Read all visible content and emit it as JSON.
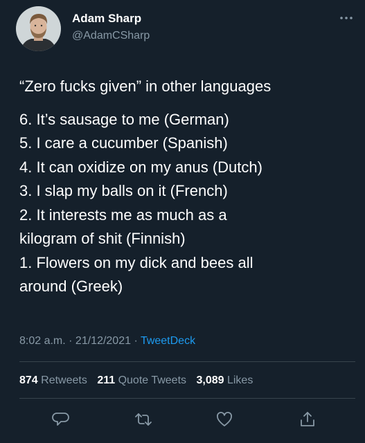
{
  "user": {
    "display_name": "Adam Sharp",
    "handle": "@AdamCSharp"
  },
  "tweet": {
    "headline": "“Zero fucks given” in other languages",
    "lines": [
      "6. It’s sausage to me (German)",
      "5. I care a cucumber (Spanish)",
      "4. It can oxidize on my anus (Dutch)",
      "3. I slap my balls on it (French)",
      "2. It interests me as much as a",
      "kilogram of shit (Finnish)",
      "1. Flowers on my dick and bees all",
      "around (Greek)"
    ]
  },
  "meta": {
    "time": "8:02 a.m.",
    "separator": " · ",
    "date": "21/12/2021",
    "source": "TweetDeck"
  },
  "stats": {
    "retweets_count": "874",
    "retweets_label": "Retweets",
    "quote_count": "211",
    "quote_label": "Quote Tweets",
    "likes_count": "3,089",
    "likes_label": "Likes"
  },
  "icons": {
    "more": "more-horizontal-icon",
    "reply": "reply-icon",
    "retweet": "retweet-icon",
    "like": "heart-icon",
    "share": "share-icon"
  },
  "colors": {
    "background": "#15202b",
    "secondary_text": "#8899a6",
    "link": "#1d9bf0",
    "divider": "#38444d"
  }
}
